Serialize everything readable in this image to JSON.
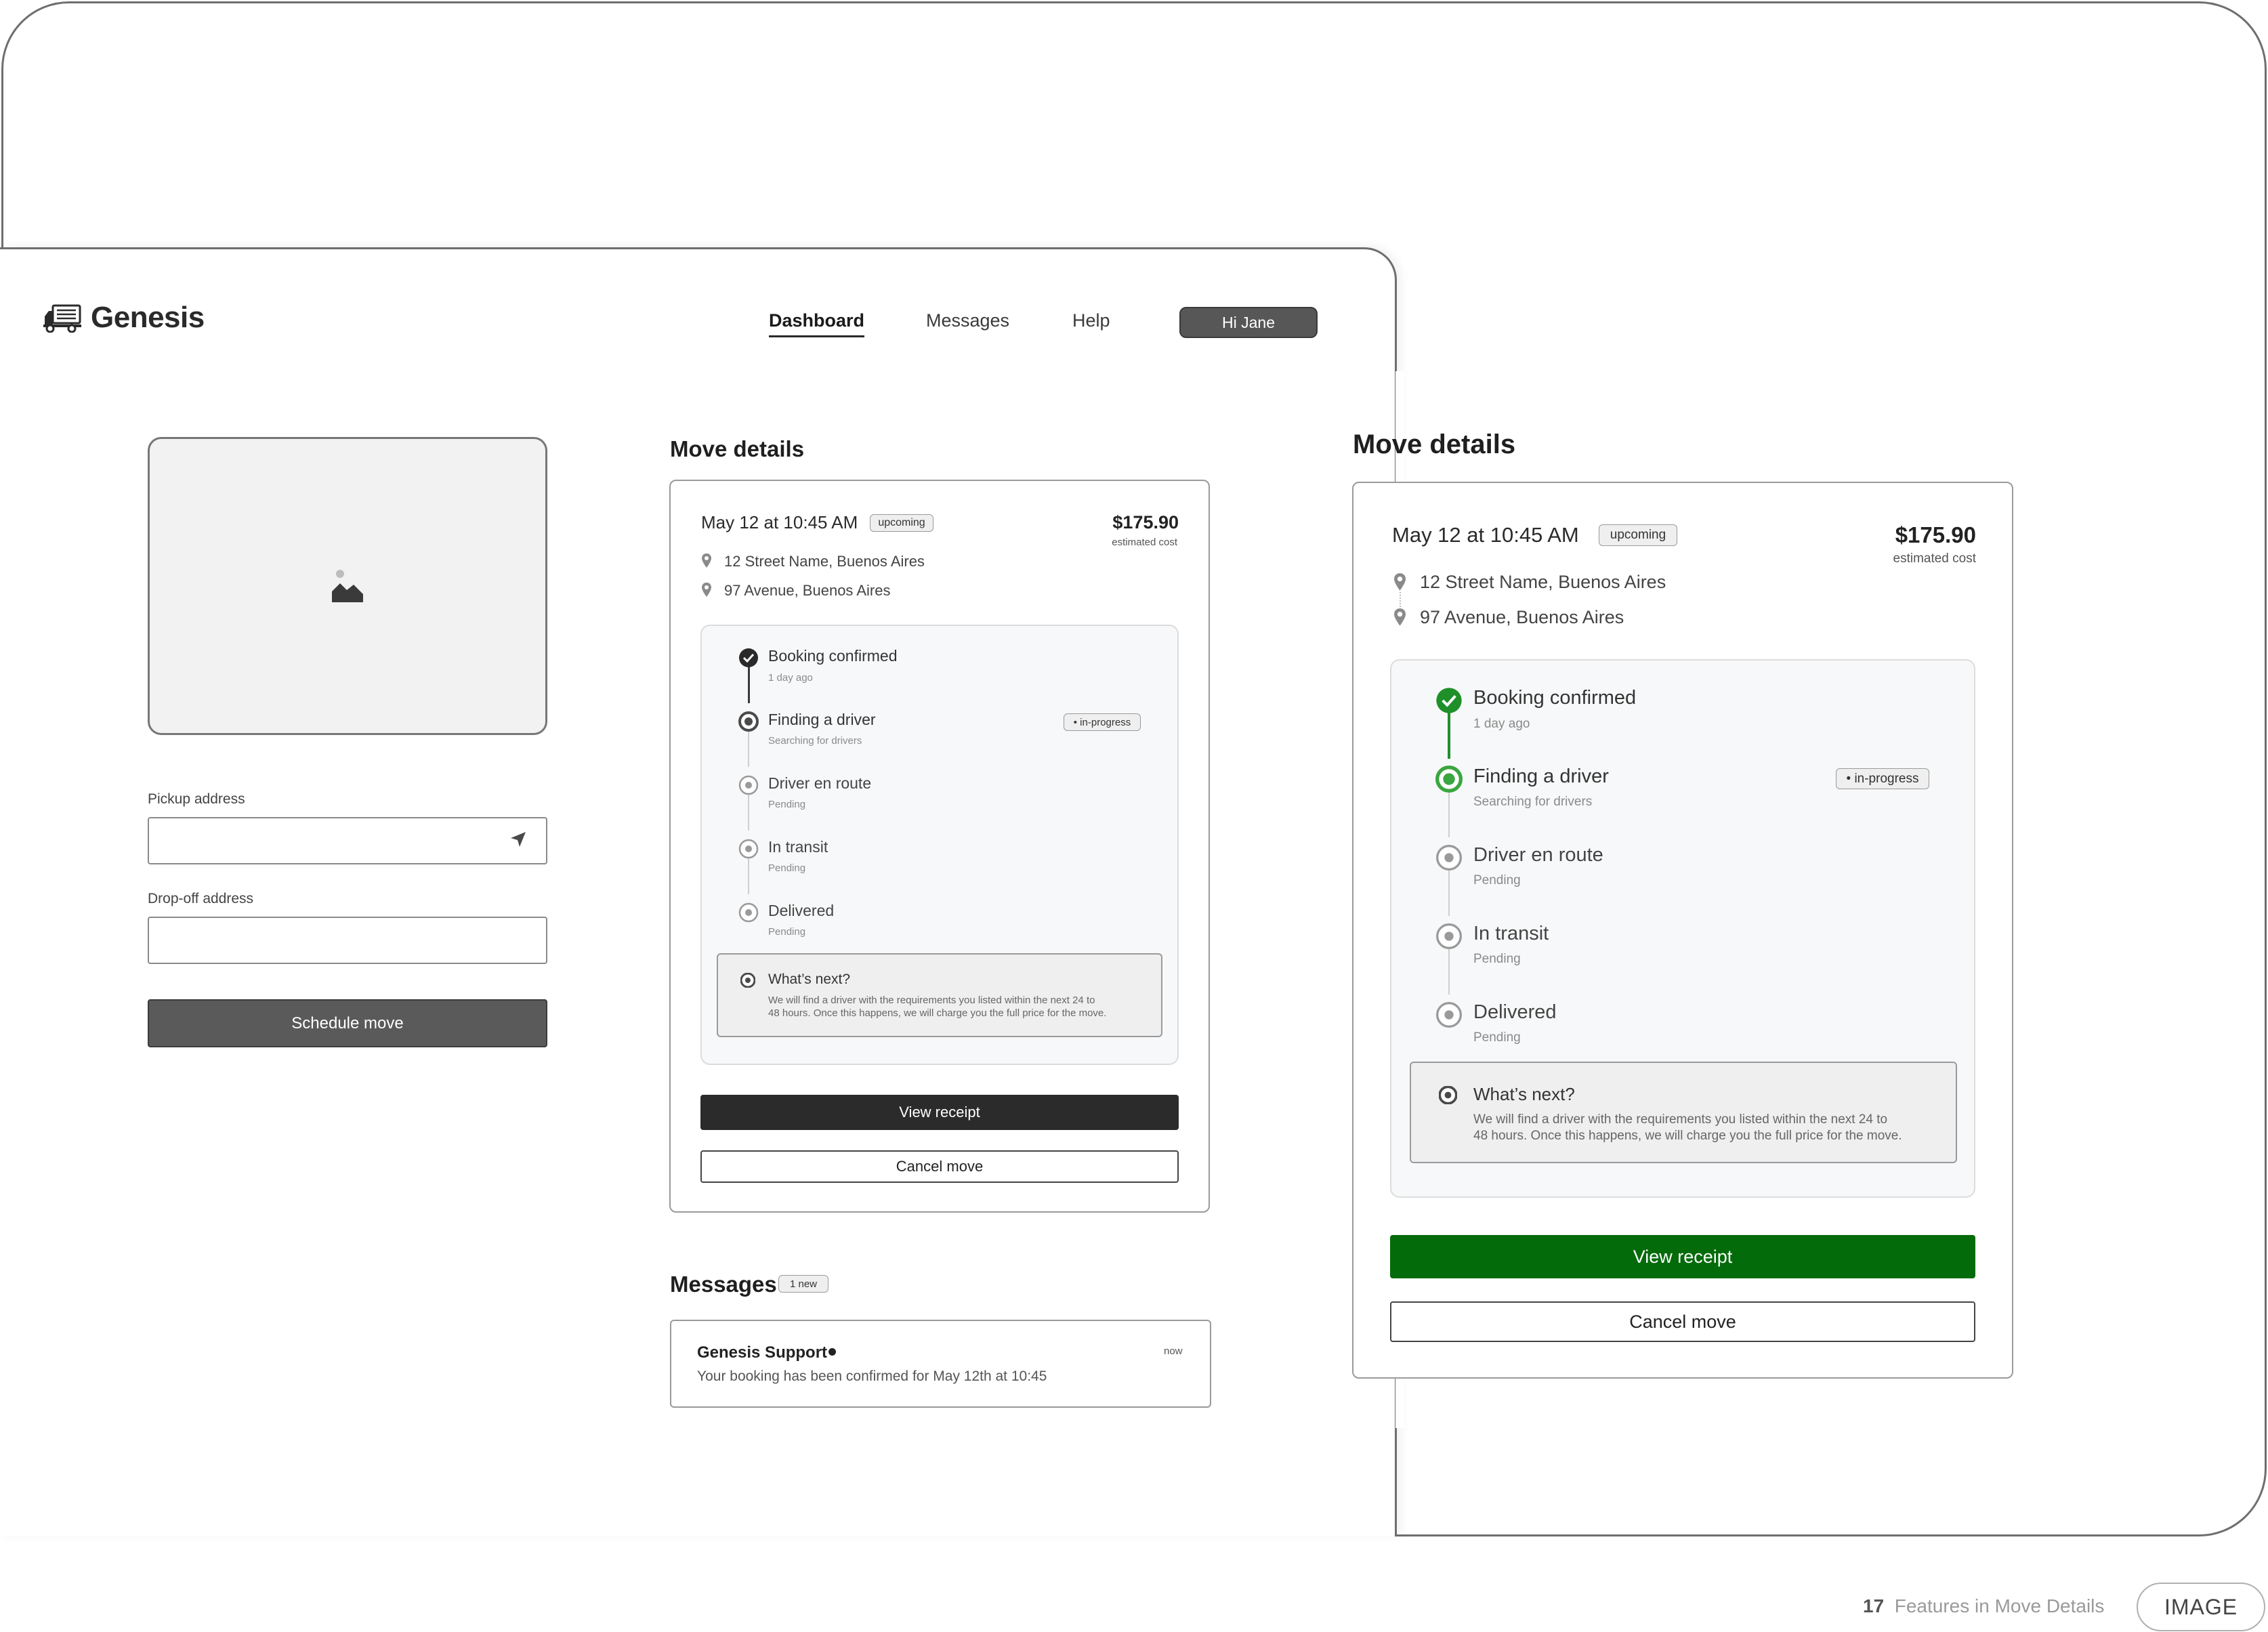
{
  "brand": {
    "name": "Genesis"
  },
  "nav": {
    "items": [
      {
        "label": "Dashboard",
        "active": true
      },
      {
        "label": "Messages",
        "active": false
      },
      {
        "label": "Help",
        "active": false
      }
    ],
    "user_button": "Hi Jane"
  },
  "booking_form": {
    "pickup_label": "Pickup address",
    "pickup_value": "",
    "dropoff_label": "Drop-off address",
    "dropoff_value": "",
    "submit_label": "Schedule move"
  },
  "move_details": {
    "title": "Move details",
    "datetime": "May 12 at 10:45 AM",
    "status_badge": "upcoming",
    "price": "$175.90",
    "price_caption": "estimated cost",
    "pickup": "12 Street Name, Buenos Aires",
    "dropoff": "97 Avenue, Buenos Aires",
    "steps": [
      {
        "label": "Booking confirmed",
        "sub": "1 day ago",
        "state": "done"
      },
      {
        "label": "Finding a driver",
        "sub": "Searching for drivers",
        "state": "active",
        "badge": "• in-progress"
      },
      {
        "label": "Driver en route",
        "sub": "Pending",
        "state": "pending"
      },
      {
        "label": "In transit",
        "sub": "Pending",
        "state": "pending"
      },
      {
        "label": "Delivered",
        "sub": "Pending",
        "state": "pending"
      }
    ],
    "next": {
      "title": "What’s next?",
      "body_line1": "We will find a driver with the requirements you listed within the next 24 to",
      "body_line2": "48 hours. Once this happens, we will charge you the full price for the move."
    },
    "view_receipt": "View receipt",
    "cancel": "Cancel move"
  },
  "messages": {
    "title": "Messages",
    "badge": "1 new",
    "items": [
      {
        "sender": "Genesis Support",
        "time": "now",
        "text": "Your booking has been confirmed for May 12th at 10:45"
      }
    ]
  },
  "footer": {
    "number": "17",
    "caption": "Features in Move Details",
    "tag": "IMAGE"
  },
  "colors": {
    "accent_green": "#046b0a",
    "step_green": "#1f8f2a",
    "dark_button": "#2b2b2b",
    "gray_button": "#5a5a5a"
  }
}
